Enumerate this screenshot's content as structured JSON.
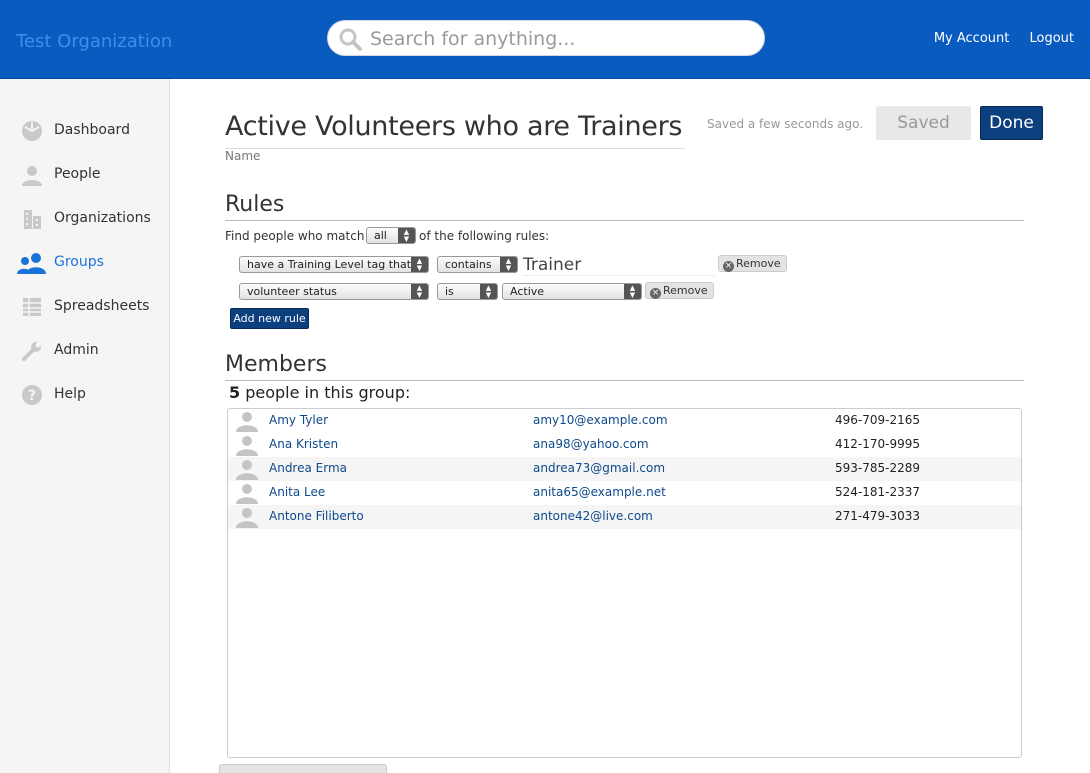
{
  "header": {
    "org_name": "Test Organization",
    "search_placeholder": "Search for anything...",
    "my_account": "My Account",
    "logout": "Logout"
  },
  "sidebar": {
    "items": [
      {
        "label": "Dashboard",
        "icon": "dashboard-icon"
      },
      {
        "label": "People",
        "icon": "person-icon"
      },
      {
        "label": "Organizations",
        "icon": "building-icon"
      },
      {
        "label": "Groups",
        "icon": "group-icon",
        "active": true
      },
      {
        "label": "Spreadsheets",
        "icon": "spreadsheet-icon"
      },
      {
        "label": "Admin",
        "icon": "wrench-icon"
      },
      {
        "label": "Help",
        "icon": "help-icon"
      }
    ],
    "active_color": "#1a73d9"
  },
  "group": {
    "name": "Active Volunteers who are Trainers",
    "name_caption": "Name",
    "saved_note": "Saved a few seconds ago.",
    "saved_label": "Saved",
    "done_label": "Done"
  },
  "rules": {
    "title": "Rules",
    "match_prefix": "Find people who match",
    "match_value": "all",
    "match_suffix": "of the following rules:",
    "rule1": {
      "field": "have a Training Level tag that",
      "operator": "contains",
      "value": "Trainer",
      "remove": "Remove"
    },
    "rule2": {
      "field": "volunteer status",
      "operator": "is",
      "value": "Active",
      "remove": "Remove"
    },
    "add_label": "Add new rule"
  },
  "members": {
    "title": "Members",
    "count": "5",
    "count_suffix": "people in this group:",
    "rows": [
      {
        "name": "Amy Tyler",
        "email": "amy10@example.com",
        "phone": "496-709-2165"
      },
      {
        "name": "Ana Kristen",
        "email": "ana98@yahoo.com",
        "phone": "412-170-9995"
      },
      {
        "name": "Andrea Erma",
        "email": "andrea73@gmail.com",
        "phone": "593-785-2289"
      },
      {
        "name": "Anita Lee",
        "email": "anita65@example.net",
        "phone": "524-181-2337"
      },
      {
        "name": "Antone Filiberto",
        "email": "antone42@live.com",
        "phone": "271-479-3033"
      }
    ]
  },
  "colors": {
    "header_bg": "#0a5bbf",
    "primary_button": "#0c3f7d",
    "link": "#0f4a8a"
  }
}
